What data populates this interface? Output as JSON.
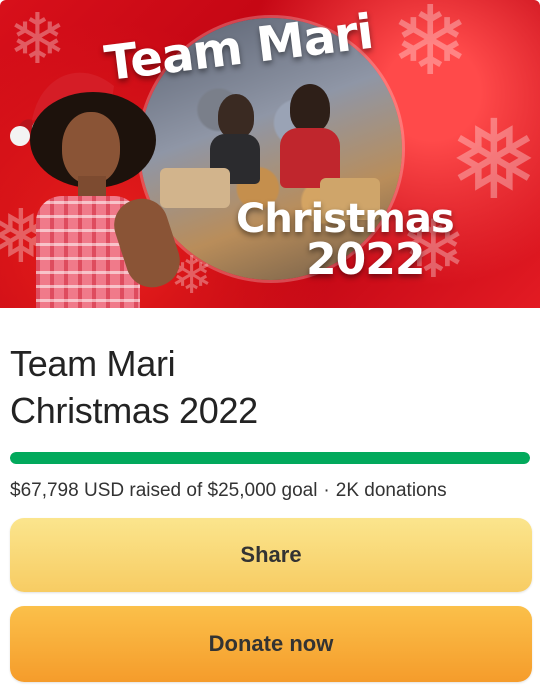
{
  "hero": {
    "title_line1": "Team Mari",
    "title_line2": "Christmas",
    "title_line3": "2022",
    "background_color": "#d8101a"
  },
  "campaign": {
    "title_line1": "Team Mari",
    "title_line2": "Christmas 2022",
    "progress_fraction": 1.0,
    "progress_color": "#02a95c",
    "raised_amount": "$67,798",
    "raised_text": "USD raised of",
    "goal_amount": "$25,000",
    "goal_text": "goal",
    "separator": "·",
    "donation_count": "2K donations"
  },
  "actions": {
    "share_label": "Share",
    "donate_label": "Donate now",
    "share_color": "#f7cc63",
    "donate_color": "#f59c2b"
  }
}
